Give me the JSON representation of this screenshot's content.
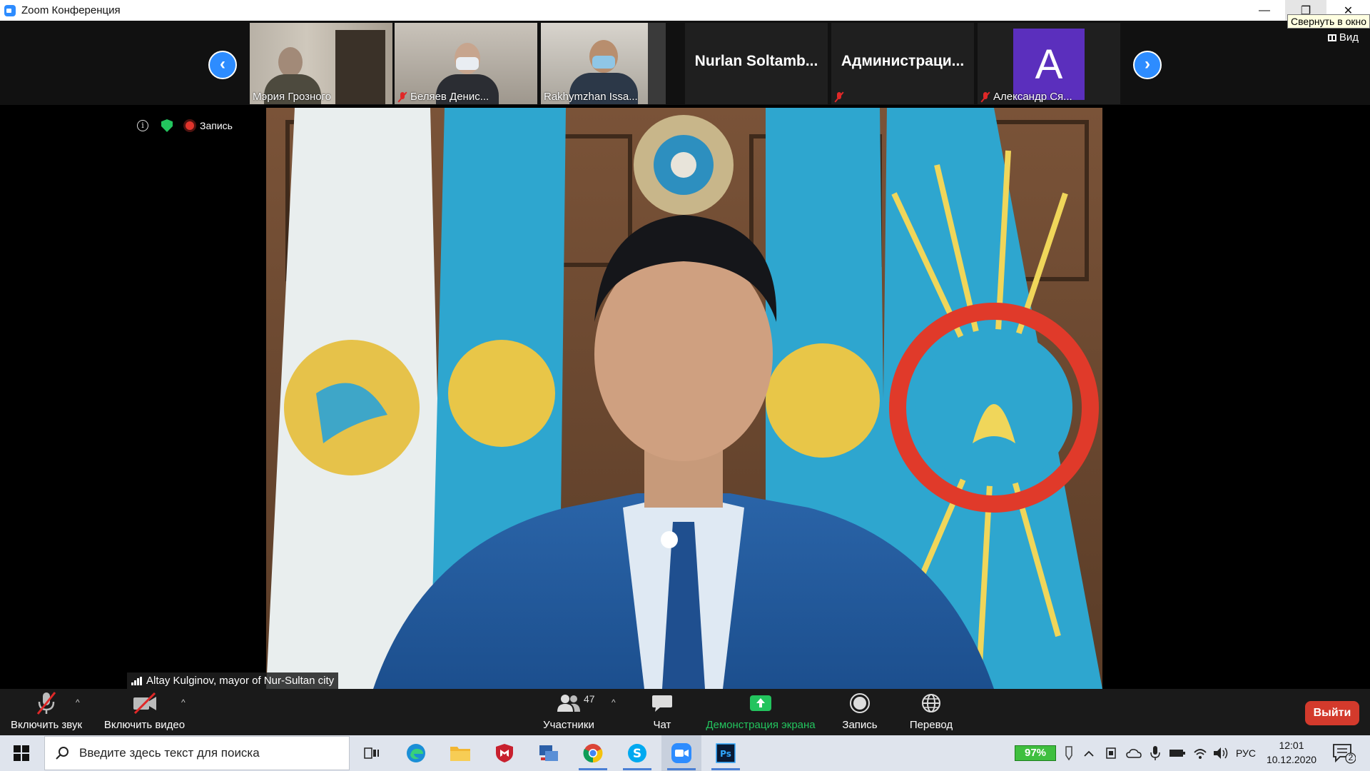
{
  "window": {
    "title": "Zoom Конференция",
    "tooltip": "Свернуть в окно",
    "minimize_glyph": "—",
    "restore_glyph": "❐",
    "close_glyph": "✕",
    "view_label": "Вид"
  },
  "strip": {
    "prev_glyph": "‹",
    "next_glyph": "›",
    "participants": [
      {
        "name": "Мэрия Грозного",
        "muted": false,
        "type": "video"
      },
      {
        "name": "Беляев Денис...",
        "muted": true,
        "type": "video"
      },
      {
        "name": "Rakhymzhan Issa...",
        "muted": false,
        "type": "video"
      },
      {
        "name": "Nurlan  Soltamb...",
        "muted": false,
        "type": "name"
      },
      {
        "name": "Администраци...",
        "muted": true,
        "type": "name"
      },
      {
        "name": "Александр Ся...",
        "muted": true,
        "type": "avatar",
        "initial": "A",
        "avatar_color": "#5b2fbd"
      }
    ]
  },
  "meeting": {
    "info_glyph": "i",
    "recording_label": "Запись",
    "speaker_name": "Altay Kulginov, mayor of Nur-Sultan city"
  },
  "controls": {
    "audio_label": "Включить звук",
    "video_label": "Включить видео",
    "participants_label": "Участники",
    "participants_count": "47",
    "chat_label": "Чат",
    "share_label": "Демонстрация экрана",
    "record_label": "Запись",
    "translate_label": "Перевод",
    "leave_label": "Выйти",
    "caret_glyph": "^"
  },
  "taskbar": {
    "search_placeholder": "Введите здесь текст для поиска",
    "battery": "97%",
    "language": "РУС",
    "time": "12:01",
    "date": "10.12.2020",
    "notifications": "2"
  },
  "colors": {
    "accent": "#2d8cff",
    "share_green": "#23c45e",
    "leave_red": "#d33a2c",
    "muted_red": "#e02828"
  }
}
